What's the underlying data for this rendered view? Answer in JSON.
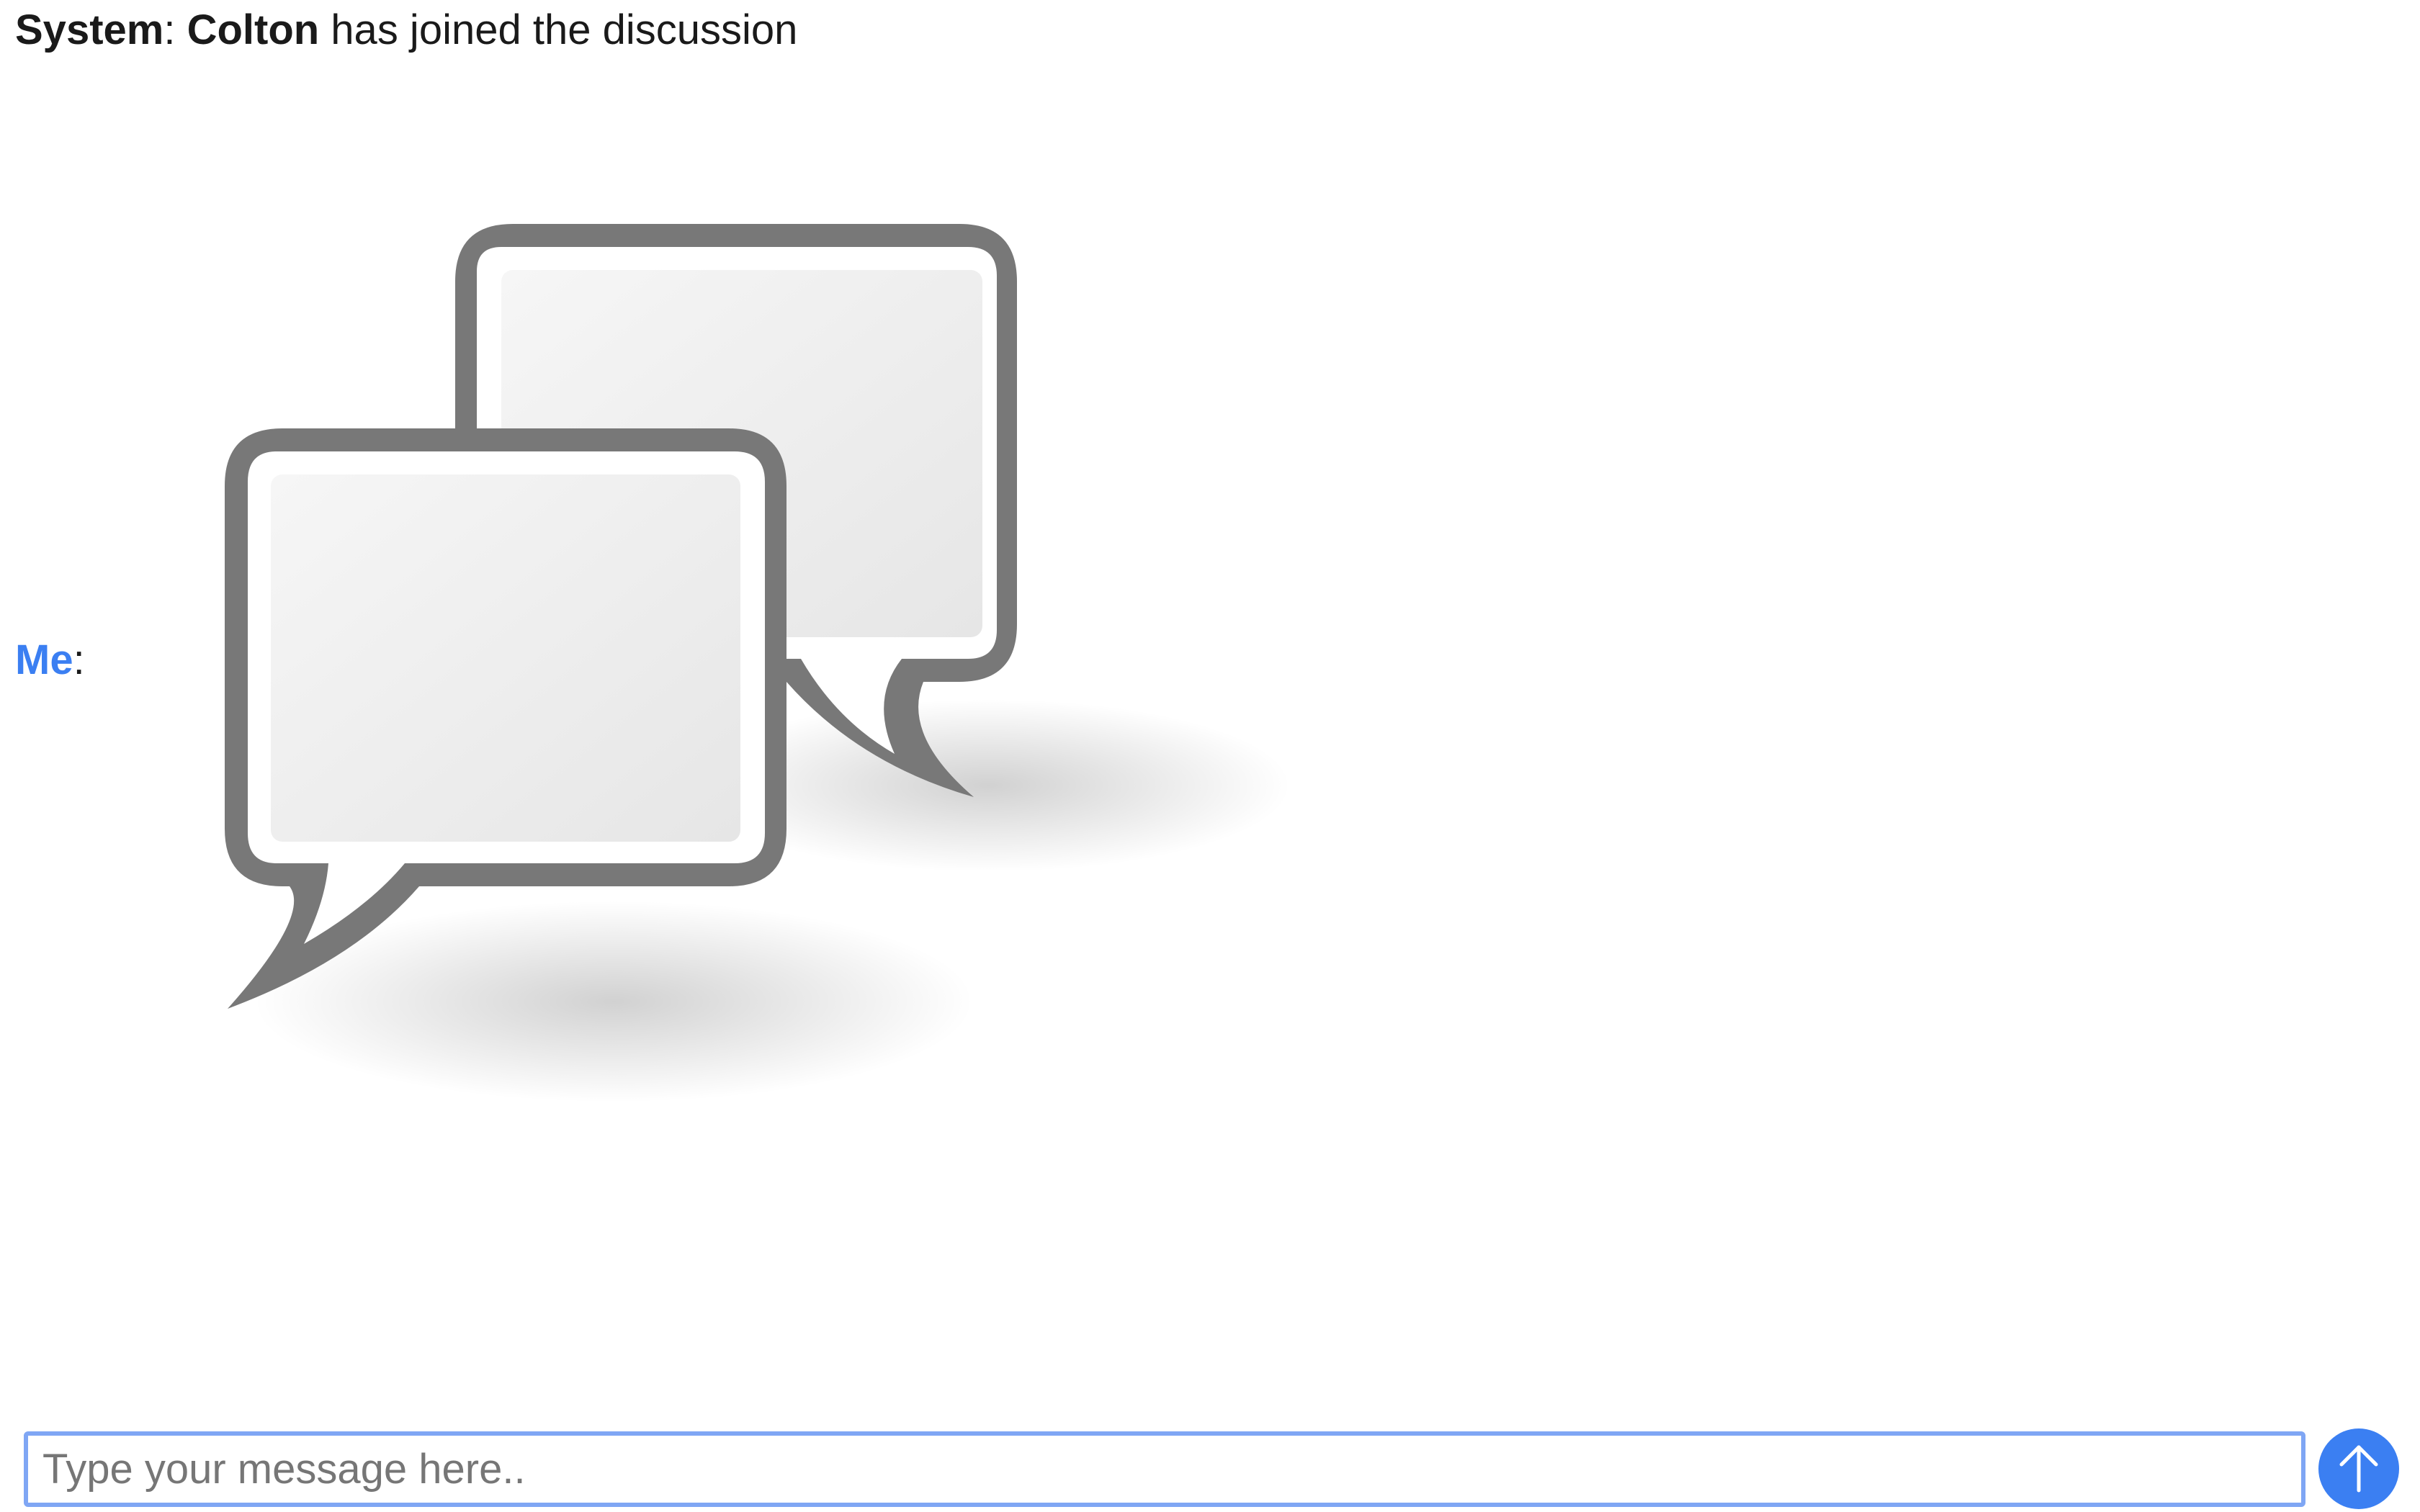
{
  "messages": [
    {
      "sender": "System",
      "sep": ": ",
      "subject": "Colton",
      "text": " has joined the discussion"
    },
    {
      "sender": "Me",
      "sep": ":",
      "attachment_icon": "speech-bubbles-icon"
    }
  ],
  "composer": {
    "placeholder": "Type your message here..",
    "value": "",
    "send_icon": "arrow-up-icon"
  },
  "colors": {
    "accent": "#3b7ff2",
    "input_border": "#7fa6f4",
    "bubble_outline": "#787878"
  }
}
